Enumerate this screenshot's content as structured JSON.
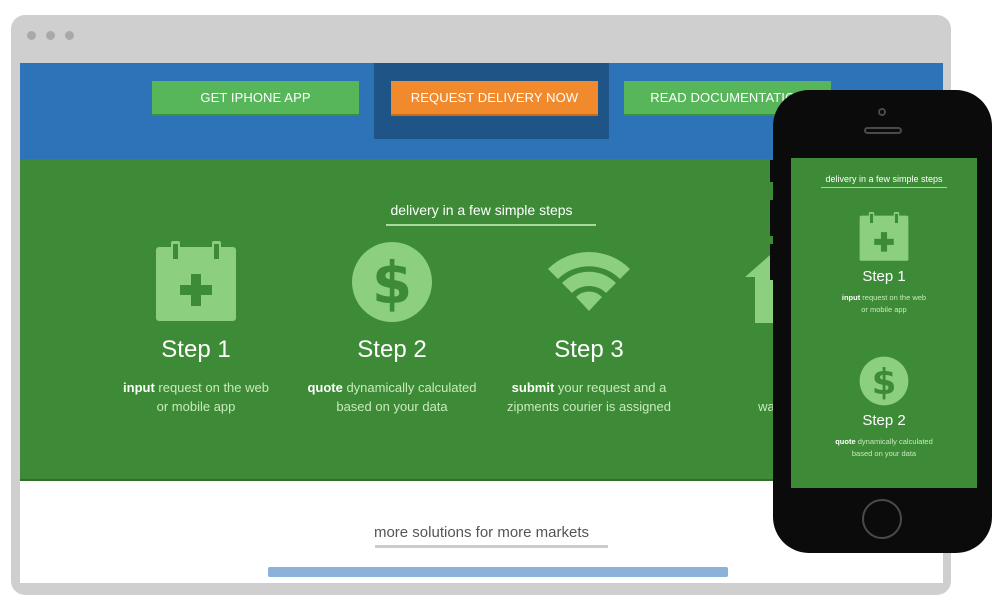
{
  "topbar": {
    "btn_iphone": "GET IPHONE APP",
    "btn_request": "REQUEST DELIVERY NOW",
    "btn_docs": "READ DOCUMENTATION"
  },
  "steps_section": {
    "title": "delivery in a few simple steps",
    "steps": [
      {
        "title": "Step 1",
        "bold": "input",
        "rest": " request on the web",
        "line2": "or mobile app",
        "icon": "calendar-plus-icon"
      },
      {
        "title": "Step 2",
        "bold": "quote",
        "rest": " dynamically calculated",
        "line2": "based on your data",
        "icon": "dollar-icon"
      },
      {
        "title": "Step 3",
        "bold": "submit",
        "rest": " your request and a",
        "line2": "zipments courier is assigned",
        "icon": "wifi-icon"
      },
      {
        "title": "St",
        "bold": "rel",
        "rest": "",
        "line2": "watch the",
        "icon": "house-icon"
      }
    ]
  },
  "more": {
    "title": "more solutions for more markets"
  },
  "phone": {
    "title": "delivery in a few simple steps",
    "steps": [
      {
        "title": "Step 1",
        "bold": "input",
        "rest": " request on the web",
        "line2": "or mobile app"
      },
      {
        "title": "Step 2",
        "bold": "quote",
        "rest": " dynamically calculated",
        "line2": "based on your data"
      }
    ]
  },
  "colors": {
    "blue": "#2c73b8",
    "green": "#3d8a37",
    "button_green": "#57b55a",
    "orange": "#f08a2c",
    "icon_green": "#8ccf7e"
  }
}
